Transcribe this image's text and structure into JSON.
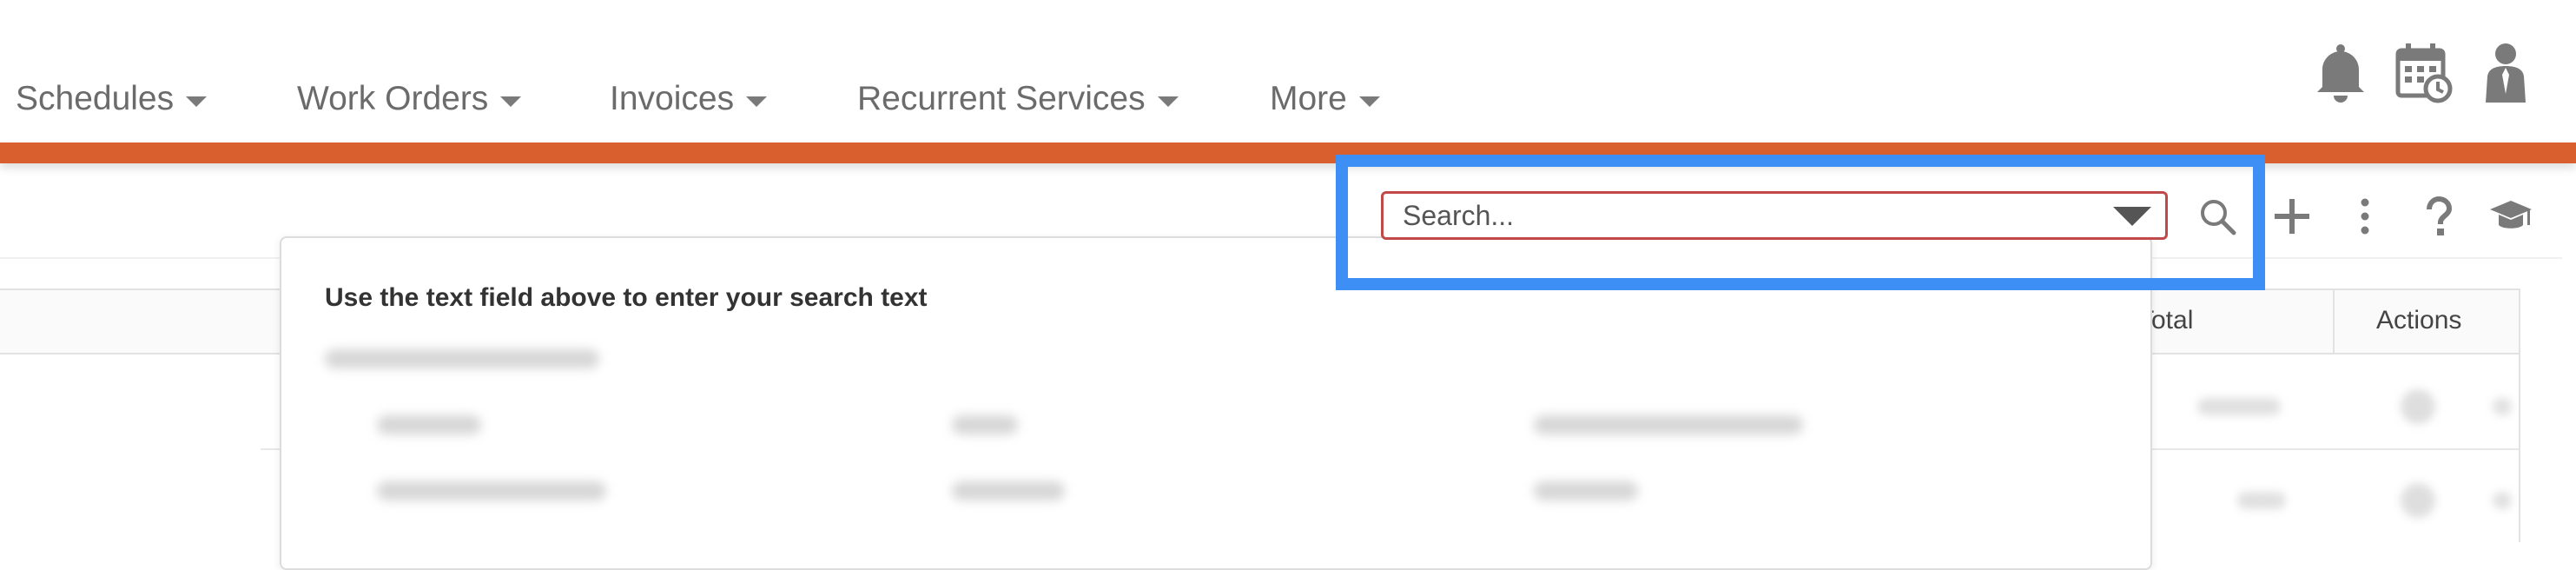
{
  "nav": {
    "items": [
      {
        "label": "Schedules"
      },
      {
        "label": "Work Orders"
      },
      {
        "label": "Invoices"
      },
      {
        "label": "Recurrent Services"
      },
      {
        "label": "More"
      }
    ],
    "icons": [
      "bell-icon",
      "calendar-clock-icon",
      "user-icon"
    ]
  },
  "toolbar": {
    "search_placeholder": "Search...",
    "icons": [
      "search-icon",
      "plus-icon",
      "more-vertical-icon",
      "help-icon",
      "graduation-cap-icon"
    ]
  },
  "search_dropdown": {
    "hint": "Use the text field above to enter your search text"
  },
  "table": {
    "columns": [
      "Total",
      "Actions"
    ]
  },
  "colors": {
    "accent_bar": "#d9602e",
    "highlight": "#3d8ef5",
    "search_border": "#c04a4a",
    "nav_text": "#6b6b6b"
  }
}
